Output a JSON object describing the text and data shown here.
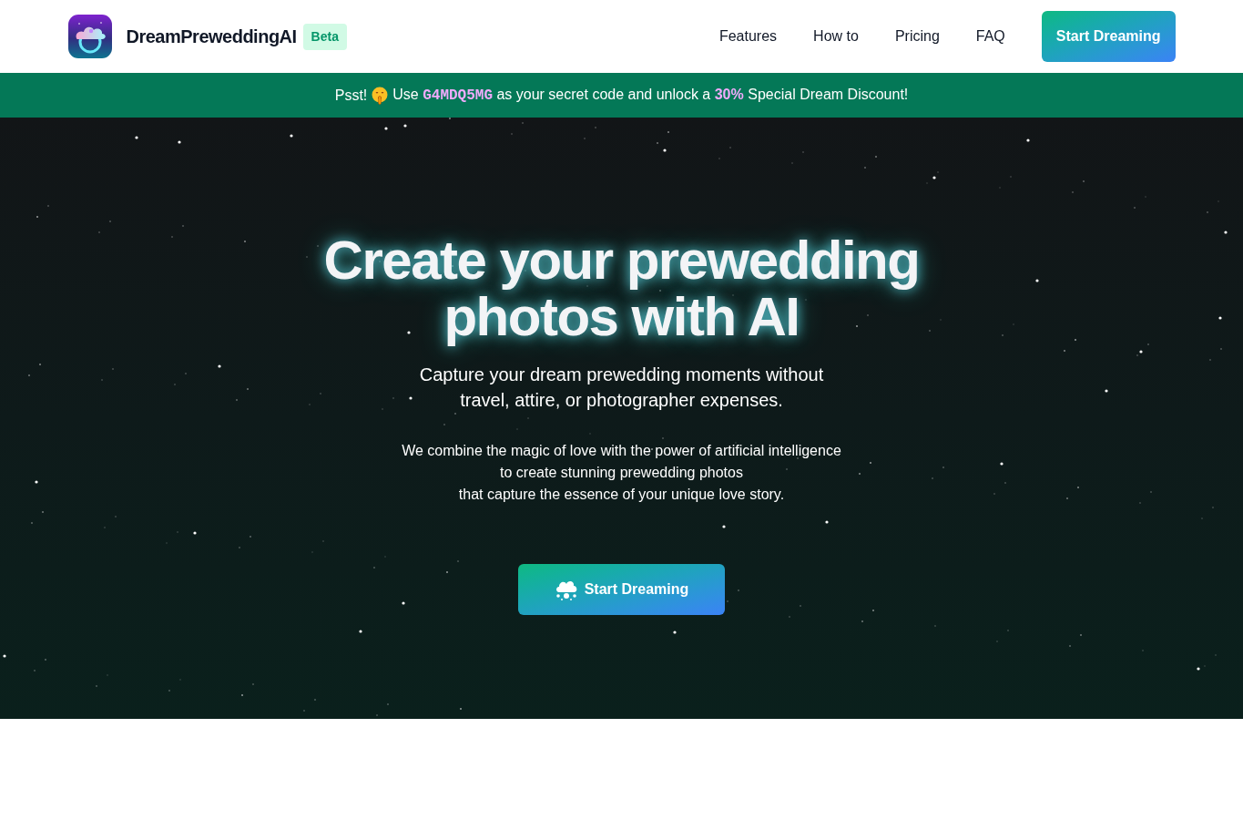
{
  "header": {
    "brand": "DreamPreweddingAI",
    "badge": "Beta",
    "nav": [
      {
        "label": "Features"
      },
      {
        "label": "How to"
      },
      {
        "label": "Pricing"
      },
      {
        "label": "FAQ"
      }
    ],
    "cta": "Start Dreaming"
  },
  "promo": {
    "greeting": "Psst!",
    "parts": [
      {
        "kind": "text",
        "text": "Use"
      },
      {
        "kind": "code",
        "text": "G4MDQ5MG"
      },
      {
        "kind": "text",
        "text": "as your secret code and unlock a"
      },
      {
        "kind": "highlight",
        "text": "30%"
      },
      {
        "kind": "text",
        "text": "Special Dream Discount!"
      }
    ]
  },
  "hero": {
    "title": "Create your prewedding photos with AI",
    "subtitle": "Capture your dream prewedding moments without travel, attire, or photographer expenses.",
    "description_lines": [
      "We combine the magic of love with the power of artificial intelligence",
      "to create stunning prewedding photos",
      "that capture the essence of your unique love story."
    ],
    "cta": "Start Dreaming"
  }
}
